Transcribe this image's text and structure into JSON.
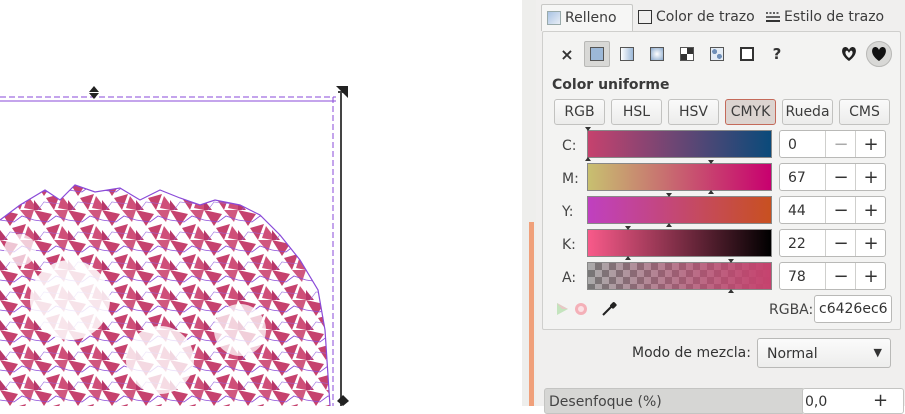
{
  "tabs": [
    {
      "label": "Relleno",
      "icon": "fill-icon"
    },
    {
      "label": "Color de trazo",
      "icon": "stroke-paint-icon"
    },
    {
      "label": "Estilo de trazo",
      "icon": "stroke-style-icon"
    }
  ],
  "fill_modes": [
    {
      "name": "no-paint",
      "glyph": "×"
    },
    {
      "name": "flat-color",
      "glyph": ""
    },
    {
      "name": "linear-gradient",
      "glyph": ""
    },
    {
      "name": "radial-gradient",
      "glyph": ""
    },
    {
      "name": "pattern",
      "glyph": ""
    },
    {
      "name": "swatch",
      "glyph": ""
    },
    {
      "name": "unset",
      "glyph": "?"
    }
  ],
  "section_title": "Color uniforme",
  "color_modes": [
    "RGB",
    "HSL",
    "HSV",
    "CMYK",
    "Rueda",
    "CMS"
  ],
  "active_color_mode": "CMYK",
  "channels": [
    {
      "label": "C:",
      "value": "0",
      "level": 0.0
    },
    {
      "label": "M:",
      "value": "67",
      "level": 0.67
    },
    {
      "label": "Y:",
      "value": "44",
      "level": 0.44
    },
    {
      "label": "K:",
      "value": "22",
      "level": 0.22
    },
    {
      "label": "A:",
      "value": "78",
      "level": 0.78
    }
  ],
  "rgba_label": "RGBA:",
  "rgba_value": "c6426ec6",
  "blend_label": "Modo de mezcla:",
  "blend_value": "Normal",
  "blur_label": "Desenfoque (%)",
  "blur_value": "0,0",
  "colors": {
    "shape_fill": "#c6426e",
    "shape_stroke": "#8a4ad8",
    "accent": "#f0a07a"
  }
}
